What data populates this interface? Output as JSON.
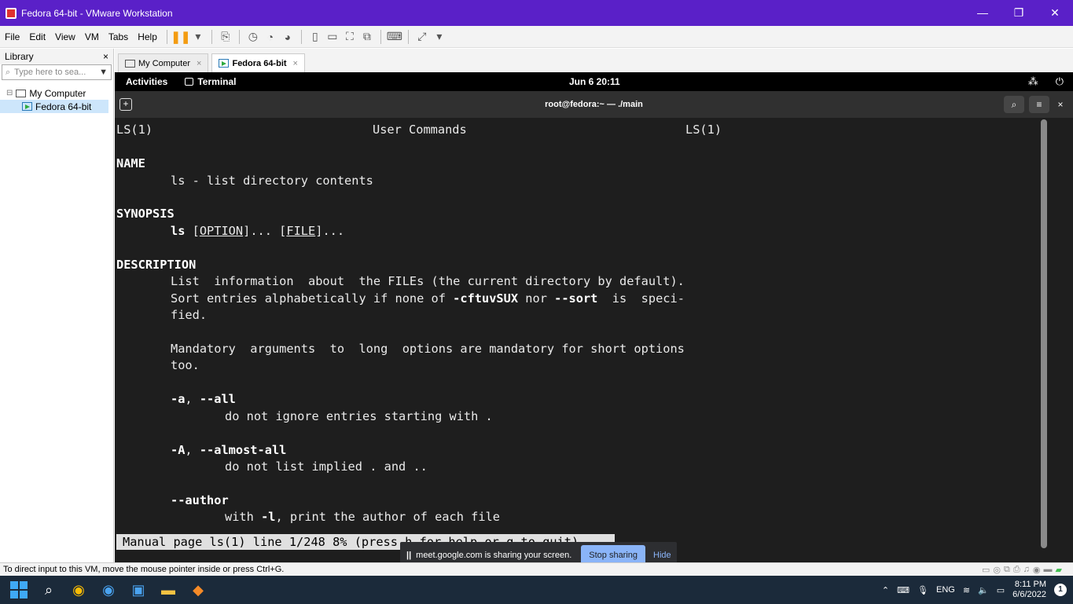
{
  "window": {
    "title": "Fedora 64-bit - VMware Workstation",
    "controls": [
      "—",
      "❐",
      "✕"
    ]
  },
  "menu": {
    "items": [
      "File",
      "Edit",
      "View",
      "VM",
      "Tabs",
      "Help"
    ]
  },
  "library": {
    "title": "Library",
    "close": "×",
    "search_placeholder": "Type here to sea...",
    "tree": {
      "root": "My Computer",
      "child": "Fedora 64-bit"
    }
  },
  "tabs": [
    {
      "label": "My Computer",
      "close": "×"
    },
    {
      "label": "Fedora 64-bit",
      "close": "×"
    }
  ],
  "gnome": {
    "activities": "Activities",
    "app": "Terminal",
    "clock": "Jun 6 20:11",
    "net_icon": "network-icon",
    "power_icon": "power-icon"
  },
  "terminal": {
    "title": "root@fedora:~ — ./main",
    "lines": {
      "header_left": "LS(1)",
      "header_center": "User Commands",
      "header_right": "LS(1)",
      "name_head": "NAME",
      "name_desc": "ls - list directory contents",
      "synopsis_head": "SYNOPSIS",
      "syn_cmd": "ls",
      "syn_opt": "OPTION",
      "syn_mid": "... [",
      "syn_file": "FILE",
      "syn_end": "]...",
      "syn_open": " [",
      "desc_head": "DESCRIPTION",
      "desc1": "List  information  about  the FILEs (the current directory by default).",
      "desc2_a": "Sort entries alphabetically if none of ",
      "desc2_b": "-cftuvSUX",
      "desc2_c": " nor ",
      "desc2_d": "--sort",
      "desc2_e": "  is  speci-",
      "desc3": "fied.",
      "mand1": "Mandatory  arguments  to  long  options are mandatory for short options",
      "mand2": "too.",
      "opt_a1": "-a",
      "opt_a_sep": ", ",
      "opt_a2": "--all",
      "opt_a_desc": "do not ignore entries starting with .",
      "opt_A1": "-A",
      "opt_A_sep": ", ",
      "opt_A2": "--almost-all",
      "opt_A_desc": "do not list implied . and ..",
      "opt_author": "--author",
      "opt_author_a": "with ",
      "opt_author_b": "-l",
      "opt_author_c": ", print the author of each file"
    },
    "status": "Manual page ls(1) line 1/248 8% (press h for help or q to quit)"
  },
  "sharebar": {
    "pause": "||",
    "message": "meet.google.com is sharing your screen.",
    "stop": "Stop sharing",
    "hide": "Hide"
  },
  "statusbar": {
    "text": "To direct input to this VM, move the mouse pointer inside or press Ctrl+G."
  },
  "taskbar": {
    "lang": "ENG",
    "time": "8:11 PM",
    "date": "6/6/2022",
    "notifications": "1"
  }
}
